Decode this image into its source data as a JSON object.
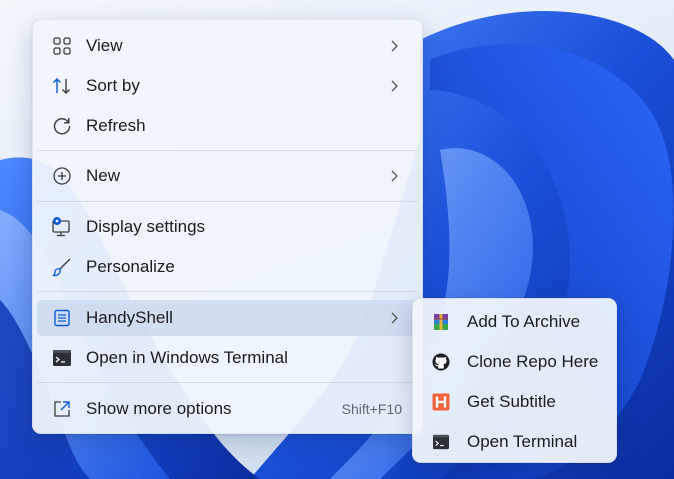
{
  "main_menu": {
    "items": [
      {
        "label": "View",
        "icon": "grid-icon",
        "has_submenu": true
      },
      {
        "label": "Sort by",
        "icon": "sort-arrows-icon",
        "has_submenu": true
      },
      {
        "label": "Refresh",
        "icon": "refresh-icon",
        "has_submenu": false
      },
      {
        "label": "New",
        "icon": "plus-circle-icon",
        "has_submenu": true
      },
      {
        "label": "Display settings",
        "icon": "display-settings-icon",
        "has_submenu": false
      },
      {
        "label": "Personalize",
        "icon": "brush-icon",
        "has_submenu": false
      },
      {
        "label": "HandyShell",
        "icon": "handyshell-icon",
        "has_submenu": true,
        "highlighted": true
      },
      {
        "label": "Open in Windows Terminal",
        "icon": "terminal-icon",
        "has_submenu": false
      },
      {
        "label": "Show more options",
        "icon": "expand-icon",
        "shortcut": "Shift+F10",
        "has_submenu": false
      }
    ]
  },
  "sub_menu": {
    "items": [
      {
        "label": "Add To Archive",
        "icon": "winrar-icon"
      },
      {
        "label": "Clone Repo Here",
        "icon": "github-icon"
      },
      {
        "label": "Get Subtitle",
        "icon": "subtitle-h-icon"
      },
      {
        "label": "Open Terminal",
        "icon": "terminal-icon"
      }
    ]
  },
  "colors": {
    "menu_bg": "#f0f5fc",
    "highlight": "#cdd9ee",
    "accent": "#0a5bd3",
    "wallpaper_blue": "#1a4fd8"
  }
}
